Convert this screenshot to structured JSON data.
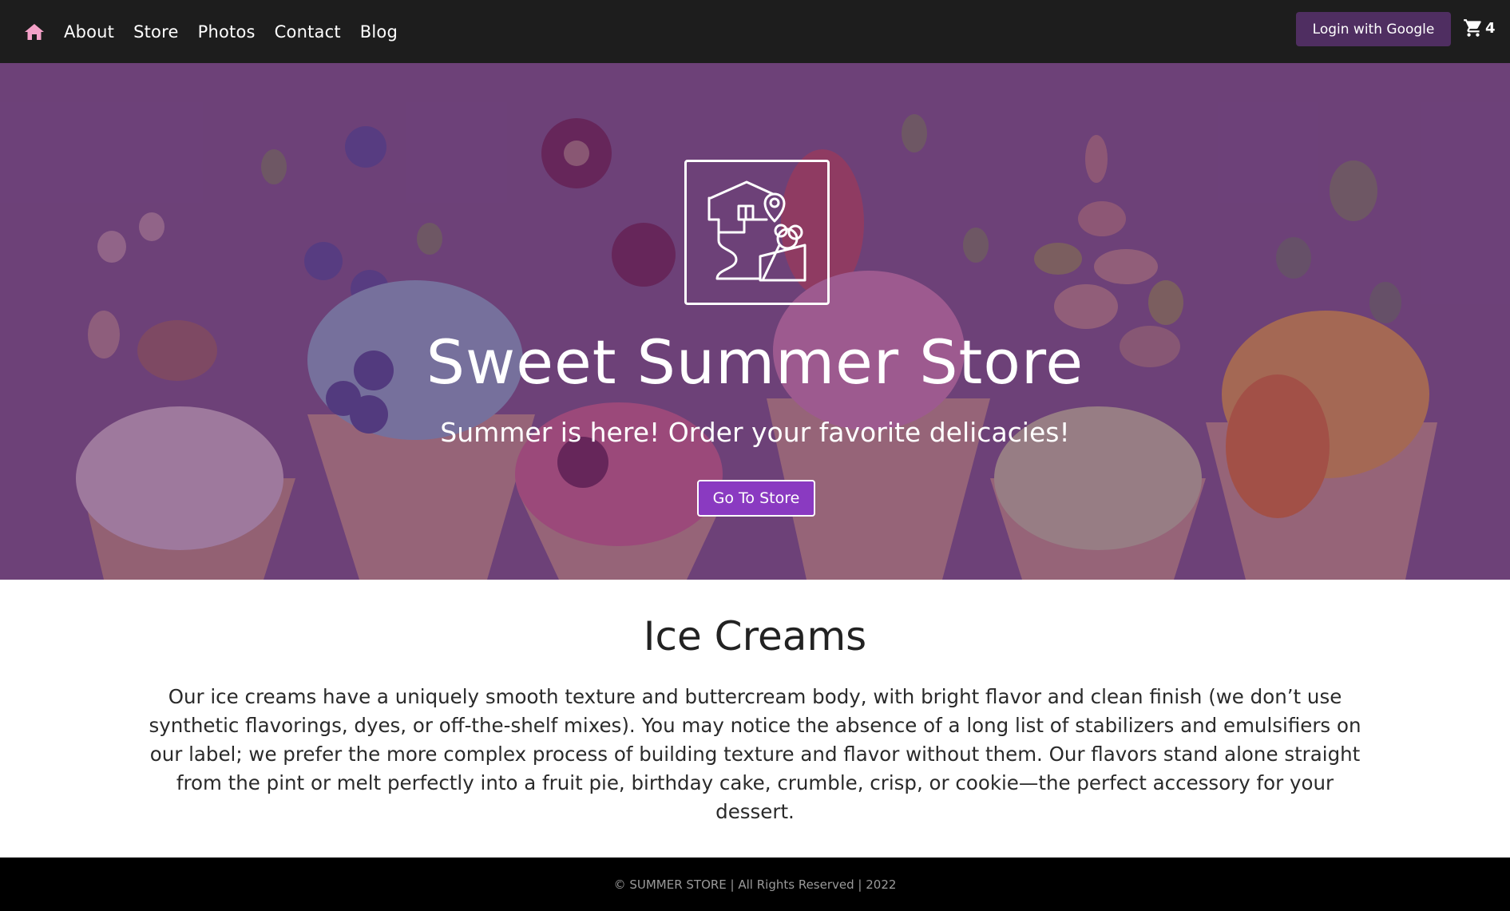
{
  "nav": {
    "home_icon": "home-icon",
    "home_color": "#f4a1c8",
    "links": [
      "About",
      "Store",
      "Photos",
      "Contact",
      "Blog"
    ],
    "login_label": "Login with Google",
    "cart_icon": "shopping-cart-icon",
    "cart_count": "4"
  },
  "hero": {
    "logo_icon": "store-location-ice-cream-icon",
    "title": "Sweet Summer Store",
    "subtitle": "Summer is here! Order your favorite delicacies!",
    "button_label": "Go To Store",
    "overlay_color": "#622d6e"
  },
  "section": {
    "title": "Ice Creams",
    "text": "Our ice creams have a uniquely smooth texture and buttercream body, with bright flavor and clean finish (we don’t use synthetic flavorings, dyes, or off-the-shelf mixes). You may notice the absence of a long list of stabilizers and emulsifiers on our label; we prefer the more complex process of building texture and flavor without them. Our flavors stand alone straight from the pint or melt perfectly into a fruit pie, birthday cake, crumble, crisp, or cookie—the perfect accessory for your dessert."
  },
  "footer": {
    "text": "© SUMMER STORE | All Rights Reserved | 2022"
  }
}
